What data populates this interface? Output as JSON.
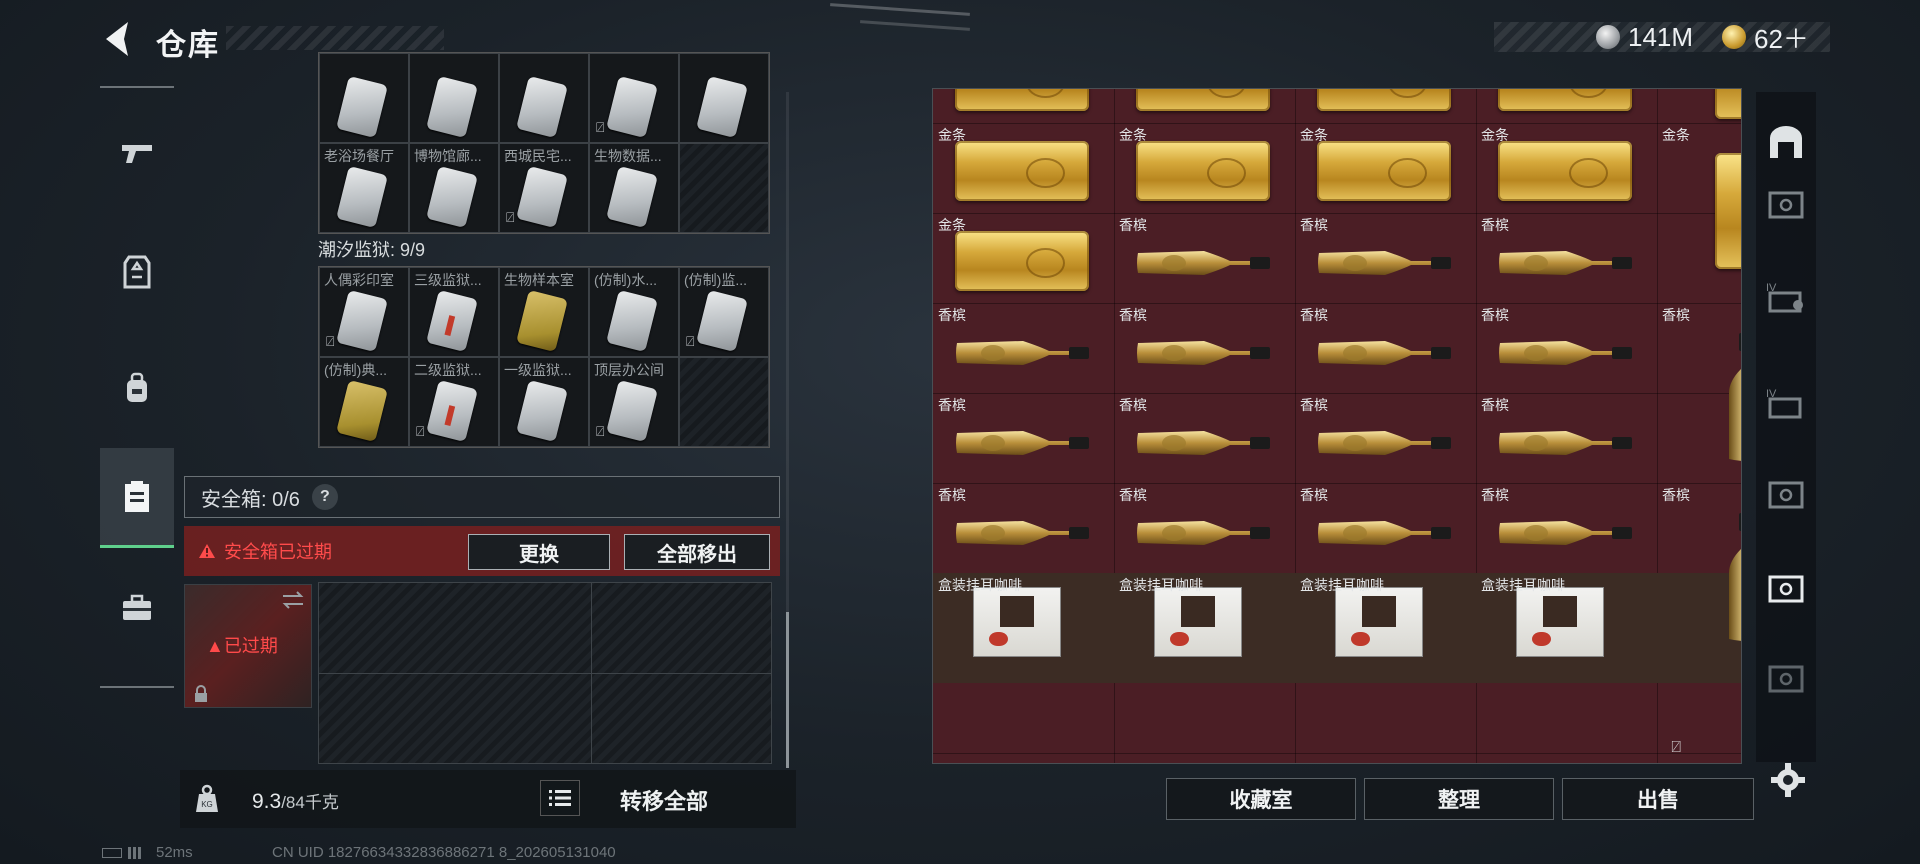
{
  "header": {
    "title": "仓库",
    "silver_amount": "141M",
    "gold_amount": "62＋"
  },
  "left_panel": {
    "top_cards": [
      {
        "label": "",
        "style": "plain"
      },
      {
        "label": "",
        "style": "plain"
      },
      {
        "label": "",
        "style": "plain"
      },
      {
        "label": "",
        "style": "plain",
        "no_icon": true
      },
      {
        "label": "",
        "style": "plain"
      },
      {
        "label": "老浴场餐厅",
        "style": "plain"
      },
      {
        "label": "博物馆廊...",
        "style": "plain"
      },
      {
        "label": "西城民宅...",
        "style": "plain",
        "no_icon": true
      },
      {
        "label": "生物数据...",
        "style": "plain"
      },
      {
        "label": "",
        "style": "empty"
      }
    ],
    "prison_title": "潮汐监狱: 9/9",
    "prison_cards": [
      {
        "label": "人偶彩印室",
        "style": "plain",
        "no_icon": true
      },
      {
        "label": "三级监狱...",
        "style": "red"
      },
      {
        "label": "生物样本室",
        "style": "yellow"
      },
      {
        "label": "(仿制)水...",
        "style": "plain"
      },
      {
        "label": "(仿制)监...",
        "style": "plain",
        "no_icon": true
      },
      {
        "label": "(仿制)典...",
        "style": "yellow"
      },
      {
        "label": "二级监狱...",
        "style": "red",
        "no_icon": true
      },
      {
        "label": "一级监狱...",
        "style": "plain"
      },
      {
        "label": "顶层办公间",
        "style": "plain",
        "no_icon": true
      },
      {
        "label": "",
        "style": "empty"
      }
    ],
    "safe_box_label": "安全箱: 0/6",
    "help_glyph": "?",
    "expired_warning": "安全箱已过期",
    "replace_button": "更换",
    "remove_all_button": "全部移出",
    "case_expired_label": "已过期",
    "weight_value": "9.3",
    "weight_max": "/84千克",
    "transfer_all_button": "转移全部"
  },
  "storage": {
    "columns": 5,
    "items": [
      {
        "name": "",
        "type": "gold",
        "col": 0,
        "row": -1
      },
      {
        "name": "",
        "type": "gold",
        "col": 1,
        "row": -1
      },
      {
        "name": "",
        "type": "gold",
        "col": 2,
        "row": -1
      },
      {
        "name": "",
        "type": "gold",
        "col": 3,
        "row": -1
      },
      {
        "name": "",
        "type": "gold_v",
        "col": 4,
        "row": -1
      },
      {
        "name": "金条",
        "type": "gold",
        "col": 0,
        "row": 0
      },
      {
        "name": "金条",
        "type": "gold",
        "col": 1,
        "row": 0
      },
      {
        "name": "金条",
        "type": "gold",
        "col": 2,
        "row": 0
      },
      {
        "name": "金条",
        "type": "gold",
        "col": 3,
        "row": 0
      },
      {
        "name": "金条",
        "type": "gold",
        "col": 0,
        "row": 1
      },
      {
        "name": "金条",
        "type": "gold",
        "col": 1,
        "row": 1
      },
      {
        "name": "金条",
        "type": "gold",
        "col": 2,
        "row": 1
      },
      {
        "name": "金条",
        "type": "gold",
        "col": 3,
        "row": 1
      },
      {
        "name": "金条",
        "type": "gold_v",
        "col": 4,
        "row": 1
      },
      {
        "name": "金条",
        "type": "gold",
        "col": 0,
        "row": 2
      },
      {
        "name": "香槟",
        "type": "champagne",
        "col": 1,
        "row": 2
      },
      {
        "name": "香槟",
        "type": "champagne",
        "col": 2,
        "row": 2
      },
      {
        "name": "香槟",
        "type": "champagne",
        "col": 3,
        "row": 2
      },
      {
        "name": "香槟",
        "type": "champagne",
        "col": 0,
        "row": 3
      },
      {
        "name": "香槟",
        "type": "champagne",
        "col": 1,
        "row": 3
      },
      {
        "name": "香槟",
        "type": "champagne",
        "col": 2,
        "row": 3
      },
      {
        "name": "香槟",
        "type": "champagne",
        "col": 3,
        "row": 3
      },
      {
        "name": "香槟",
        "type": "champagne_v",
        "col": 4,
        "row": 3
      },
      {
        "name": "香槟",
        "type": "champagne",
        "col": 0,
        "row": 4
      },
      {
        "name": "香槟",
        "type": "champagne",
        "col": 1,
        "row": 4
      },
      {
        "name": "香槟",
        "type": "champagne",
        "col": 2,
        "row": 4
      },
      {
        "name": "香槟",
        "type": "champagne",
        "col": 3,
        "row": 4
      },
      {
        "name": "香槟",
        "type": "champagne",
        "col": 0,
        "row": 5
      },
      {
        "name": "香槟",
        "type": "champagne",
        "col": 1,
        "row": 5
      },
      {
        "name": "香槟",
        "type": "champagne",
        "col": 2,
        "row": 5
      },
      {
        "name": "香槟",
        "type": "champagne",
        "col": 3,
        "row": 5
      },
      {
        "name": "香槟",
        "type": "champagne_v",
        "col": 4,
        "row": 5
      },
      {
        "name": "盒装挂耳咖啡",
        "type": "coffee",
        "col": 0,
        "row": 6
      },
      {
        "name": "盒装挂耳咖啡",
        "type": "coffee",
        "col": 1,
        "row": 6
      },
      {
        "name": "盒装挂耳咖啡",
        "type": "coffee",
        "col": 2,
        "row": 6
      },
      {
        "name": "盒装挂耳咖啡",
        "type": "coffee",
        "col": 3,
        "row": 6
      }
    ],
    "collection_button": "收藏室",
    "organize_button": "整理",
    "sell_button": "出售"
  },
  "status": {
    "ping": "52ms",
    "uid": "CN UID 18276634332836886271 8_202605131040"
  },
  "colors": {
    "accent_green": "#5fd08c",
    "warning_red": "#ff4b4b",
    "storage_bg": "#4b1e25"
  }
}
